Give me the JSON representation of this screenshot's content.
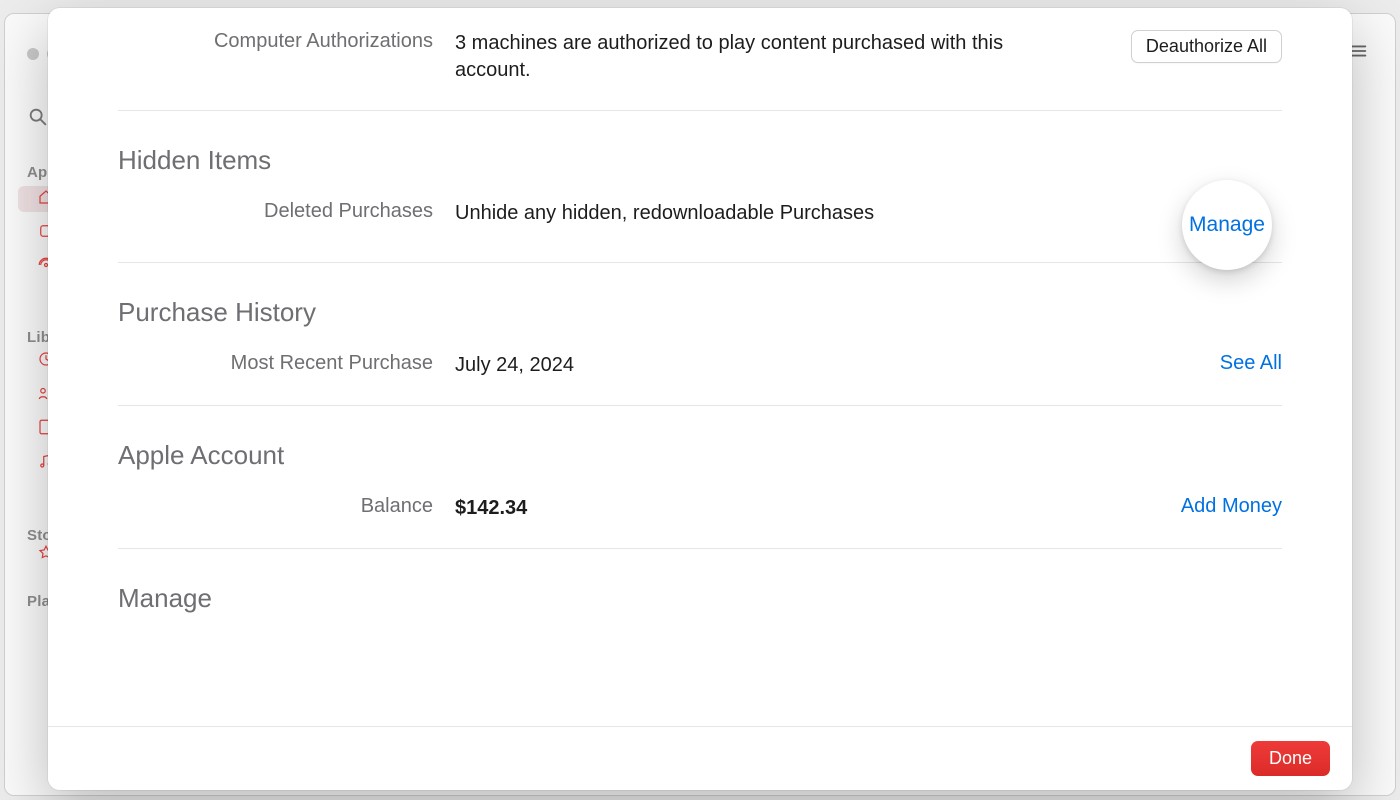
{
  "background": {
    "sidebar_labels": [
      "App",
      "Libr",
      "Sto",
      "Play"
    ]
  },
  "modal": {
    "sections": {
      "computer_auth": {
        "label": "Computer Authorizations",
        "value": "3 machines are authorized to play content purchased with this account.",
        "button": "Deauthorize All"
      },
      "hidden_items": {
        "title": "Hidden Items",
        "row_label": "Deleted Purchases",
        "row_value": "Unhide any hidden, redownloadable Purchases",
        "action": "Manage"
      },
      "purchase_history": {
        "title": "Purchase History",
        "row_label": "Most Recent Purchase",
        "row_value": "July 24, 2024",
        "action": "See All"
      },
      "apple_account": {
        "title": "Apple Account",
        "row_label": "Balance",
        "row_value": "$142.34",
        "action": "Add Money"
      },
      "manage": {
        "title": "Manage"
      }
    },
    "footer": {
      "done": "Done"
    }
  }
}
